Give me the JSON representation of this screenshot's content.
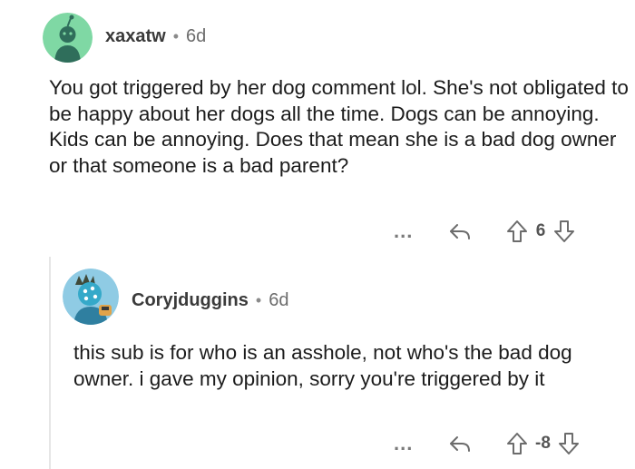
{
  "comments": [
    {
      "username": "xaxatw",
      "separator": "•",
      "age": "6d",
      "body": "You got triggered by her dog comment lol. She's not obligated to be happy about her dogs all the time. Dogs can be annoying. Kids can be annoying. Does that mean she is a bad dog owner or that someone is a bad parent?",
      "more": "...",
      "score": "6",
      "avatar_colors": {
        "bg": "#7fd8a4",
        "figure": "#2f6e5b"
      }
    },
    {
      "username": "Coryjduggins",
      "separator": "•",
      "age": "6d",
      "body": "this sub is for who is an asshole, not who's the bad dog owner. i gave my opinion, sorry you're triggered by it",
      "more": "...",
      "score": "-8",
      "avatar_colors": {
        "bg": "#8fcbe4",
        "figure": "#2f9fbf"
      }
    }
  ],
  "icons": {
    "reply": "reply-arrow-icon",
    "upvote": "upvote-arrow-icon",
    "downvote": "downvote-arrow-icon",
    "more": "more-dots-icon"
  },
  "colors": {
    "text": "#1c1c1c",
    "meta": "#6c6c6c",
    "thread_line": "#e6e6e6"
  }
}
